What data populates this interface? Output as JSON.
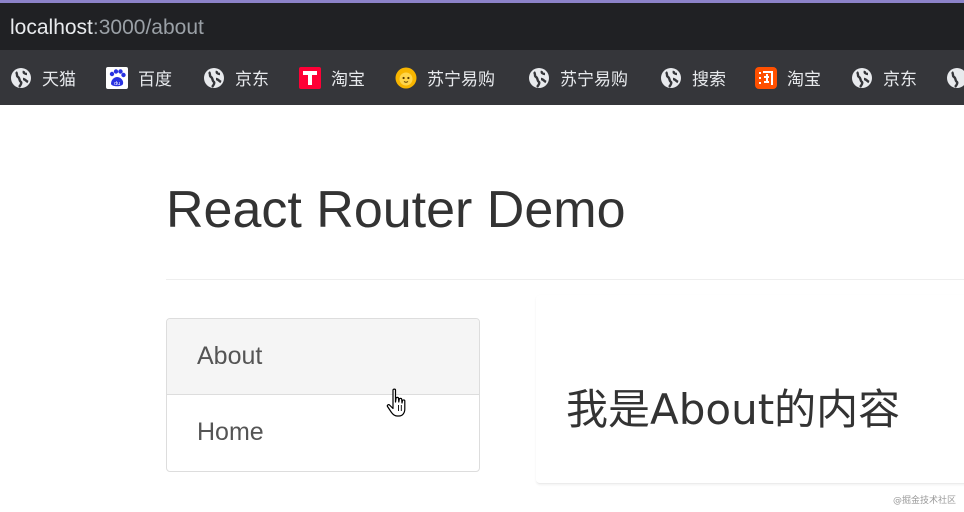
{
  "browser": {
    "url_host": "localhost",
    "url_path": ":3000/about",
    "bookmarks": [
      {
        "label": "天猫",
        "icon": "globe-icon"
      },
      {
        "label": "百度",
        "icon": "baidu-paw-icon"
      },
      {
        "label": "京东",
        "icon": "globe-icon"
      },
      {
        "label": "淘宝",
        "icon": "tmall-t-icon"
      },
      {
        "label": "苏宁易购",
        "icon": "suning-lion-icon"
      },
      {
        "label": "苏宁易购",
        "icon": "globe-icon"
      },
      {
        "label": "搜索",
        "icon": "globe-icon"
      },
      {
        "label": "淘宝",
        "icon": "taobao-icon"
      },
      {
        "label": "京东",
        "icon": "globe-icon"
      }
    ]
  },
  "page": {
    "title": "React Router Demo",
    "nav": [
      {
        "label": "About",
        "active": true
      },
      {
        "label": "Home",
        "active": false
      }
    ],
    "content_text": "我是About的内容"
  },
  "watermark": "@掘金技术社区",
  "colors": {
    "urlbar_bg": "#202124",
    "bookmarks_bg": "#35363a",
    "active_nav_bg": "#f5f5f5",
    "title_text": "#333333"
  }
}
